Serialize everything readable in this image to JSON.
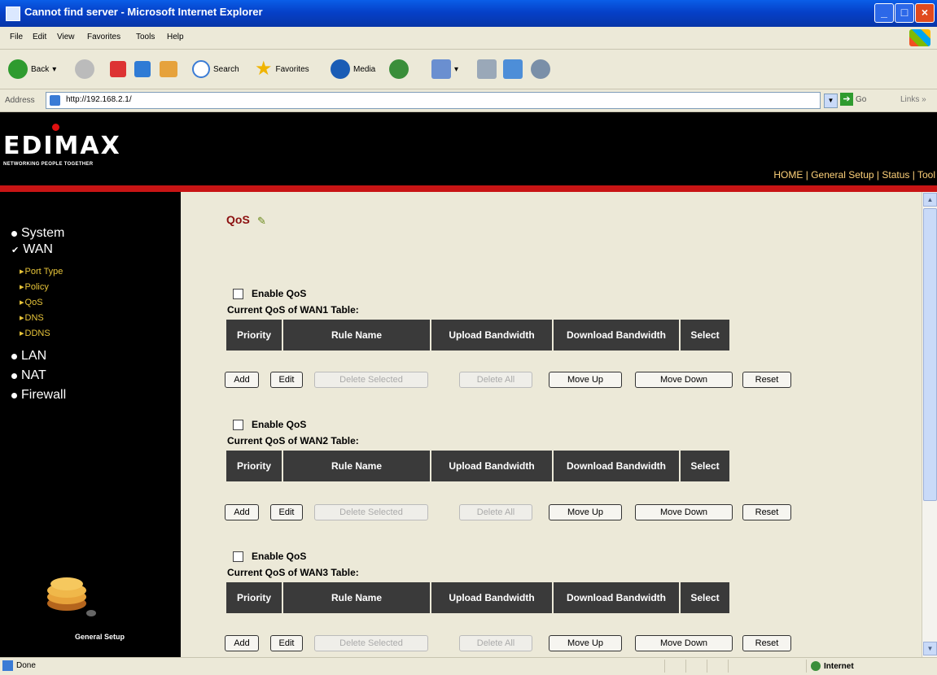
{
  "window": {
    "title": "Cannot find server - Microsoft Internet Explorer"
  },
  "menu": [
    "File",
    "Edit",
    "View",
    "Favorites",
    "Tools",
    "Help"
  ],
  "toolbar": {
    "back": "Back",
    "search": "Search",
    "favorites": "Favorites",
    "media": "Media"
  },
  "address": {
    "label": "Address",
    "url": "http://192.168.2.1/",
    "go": "Go",
    "links": "Links"
  },
  "banner": {
    "logo": "EDIMAX",
    "tagline": "NETWORKING PEOPLE TOGETHER",
    "nav": [
      "HOME",
      "General Setup",
      "Status",
      "Tool"
    ],
    "separator": " | "
  },
  "sidebar": {
    "items": [
      "System",
      "WAN",
      "LAN",
      "NAT",
      "Firewall"
    ],
    "wan_sub": [
      "Port Type",
      "Policy",
      "QoS",
      "DNS",
      "DDNS"
    ],
    "footer": "General Setup"
  },
  "page": {
    "title": "QoS"
  },
  "sections": [
    {
      "enable_label": "Enable QoS",
      "table_label": "Current QoS of WAN1 Table:"
    },
    {
      "enable_label": "Enable QoS",
      "table_label": "Current QoS of WAN2 Table:"
    },
    {
      "enable_label": "Enable QoS",
      "table_label": "Current QoS of WAN3 Table:"
    }
  ],
  "columns": [
    "Priority",
    "Rule Name",
    "Upload Bandwidth",
    "Download Bandwidth",
    "Select"
  ],
  "buttons": [
    "Add",
    "Edit",
    "Delete Selected",
    "Delete All",
    "Move Up",
    "Move Down",
    "Reset"
  ],
  "status": {
    "text": "Done",
    "zone": "Internet"
  }
}
